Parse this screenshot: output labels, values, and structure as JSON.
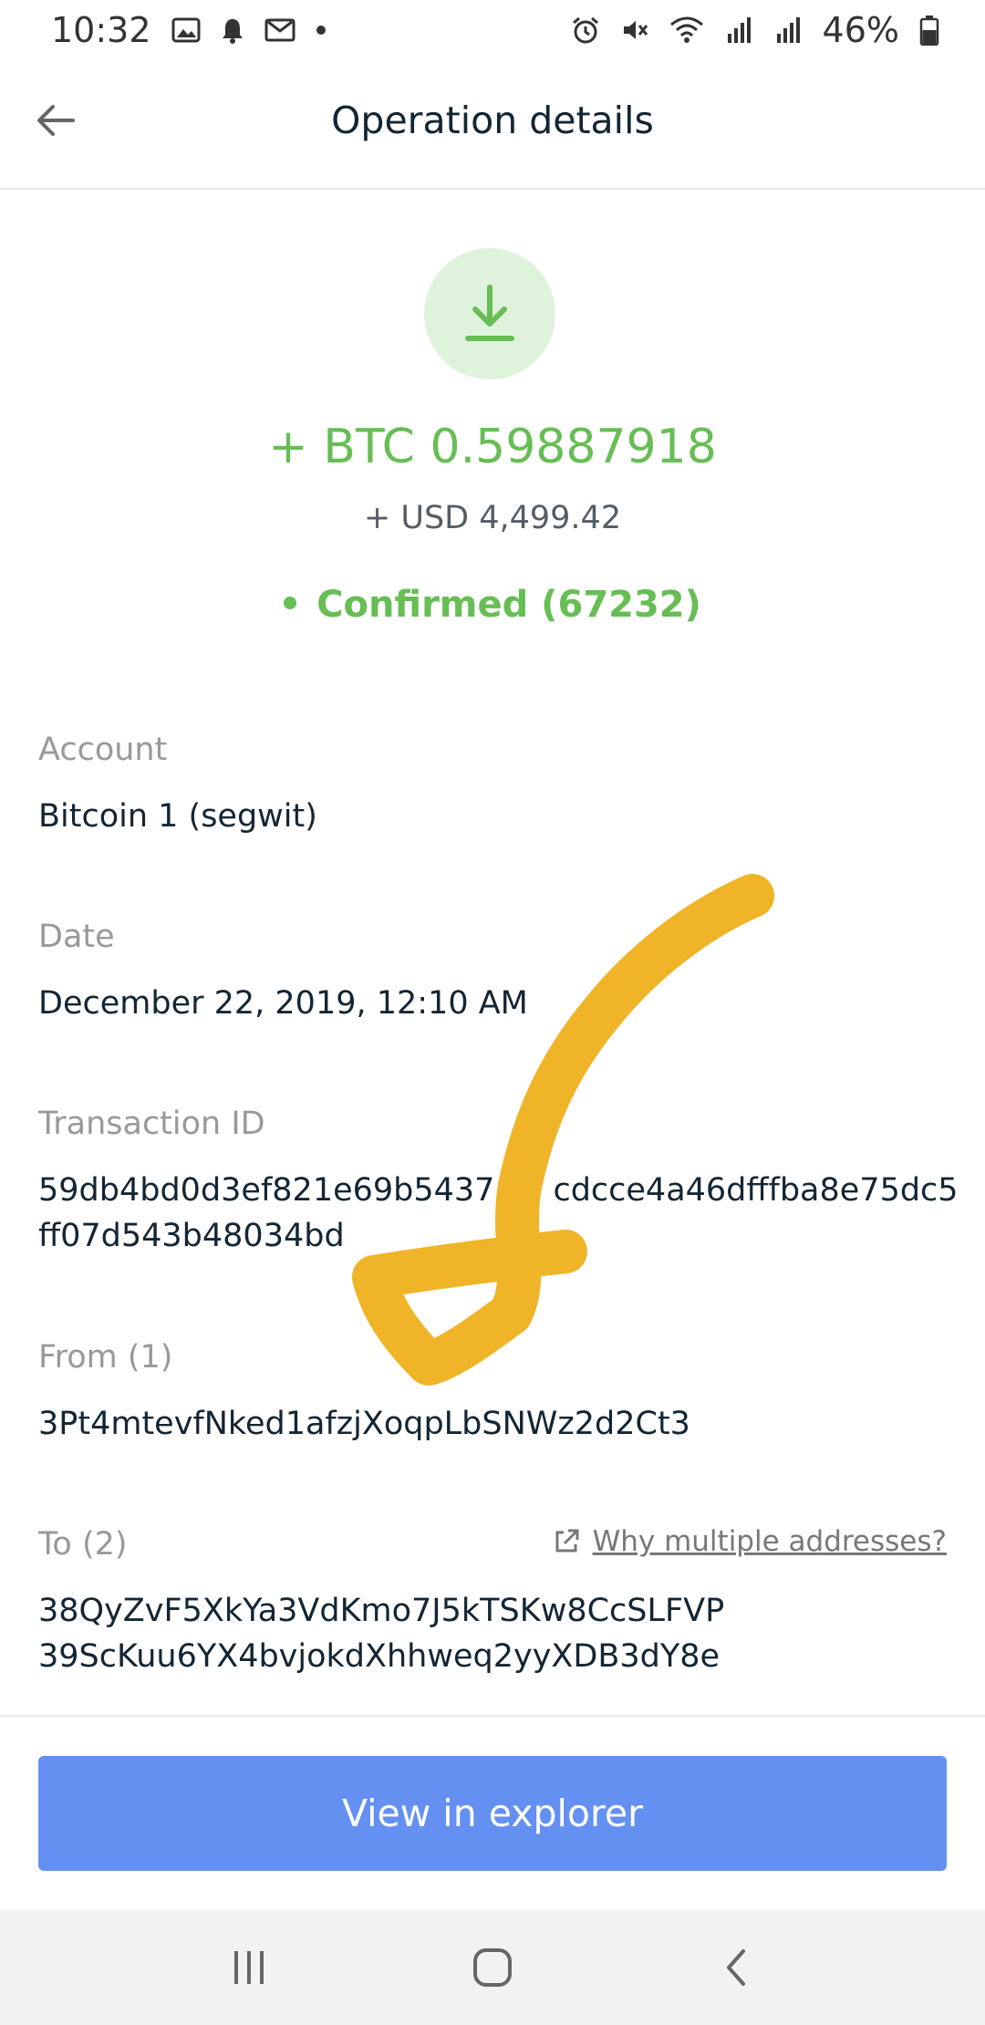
{
  "status_bar": {
    "time": "10:32",
    "battery": "46%",
    "icons": [
      "image-icon",
      "notification-bell-icon",
      "gmail-icon",
      "dot-icon",
      "alarm-icon",
      "mute-icon",
      "wifi-icon",
      "signal-icon",
      "signal-icon",
      "battery-icon"
    ]
  },
  "header": {
    "title": "Operation details",
    "back_icon": "arrow-left-icon"
  },
  "summary": {
    "icon": "download-arrow-icon",
    "amount": "+ BTC 0.59887918",
    "countervalue": "+ USD 4,499.42",
    "status": "Confirmed (67232)",
    "accent_color": "#66be54"
  },
  "details": {
    "account_label": "Account",
    "account_value": "Bitcoin 1 (segwit)",
    "date_label": "Date",
    "date_value": "December 22, 2019, 12:10 AM",
    "txid_label": "Transaction ID",
    "txid_lines": [
      "59db4bd0d3ef821e69b5437",
      "cdcce4a46dfffba8e75dc5",
      "ff07d543b48034bd"
    ],
    "from_label": "From (1)",
    "from_value": "3Pt4mtevfNked1afzjXoqpLbSNWz2d2Ct3",
    "to_label": "To (2)",
    "to_values": [
      "38QyZvF5XkYa3VdKmo7J5kTSKw8CcSLFVP",
      "39ScKuu6YX4bvjokdXhhweq2yyXDB3dY8e"
    ],
    "why_link": "Why multiple addresses?"
  },
  "footer": {
    "button_label": "View in explorer",
    "button_color": "#6490f1"
  },
  "nav_bar": {
    "icons": [
      "recent-apps-icon",
      "home-icon",
      "nav-back-icon"
    ]
  },
  "annotation": {
    "color": "#f0b429"
  }
}
